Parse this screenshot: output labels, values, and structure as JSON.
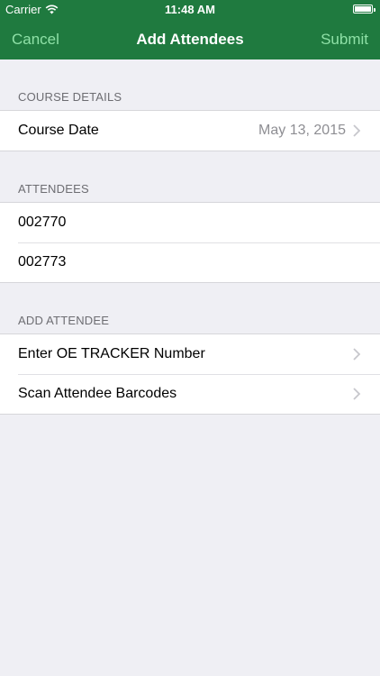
{
  "status_bar": {
    "carrier": "Carrier",
    "time": "11:48 AM"
  },
  "nav": {
    "cancel": "Cancel",
    "title": "Add Attendees",
    "submit": "Submit"
  },
  "sections": {
    "course_details": {
      "header": "COURSE DETAILS",
      "course_date_label": "Course Date",
      "course_date_value": "May 13, 2015"
    },
    "attendees": {
      "header": "ATTENDEES",
      "items": [
        "002770",
        "002773"
      ]
    },
    "add_attendee": {
      "header": "ADD ATTENDEE",
      "enter_label": "Enter OE TRACKER Number",
      "scan_label": "Scan Attendee Barcodes"
    }
  },
  "colors": {
    "nav_background": "#1f7a3f",
    "nav_button_text": "#8ee0a6",
    "background": "#efeff4"
  }
}
